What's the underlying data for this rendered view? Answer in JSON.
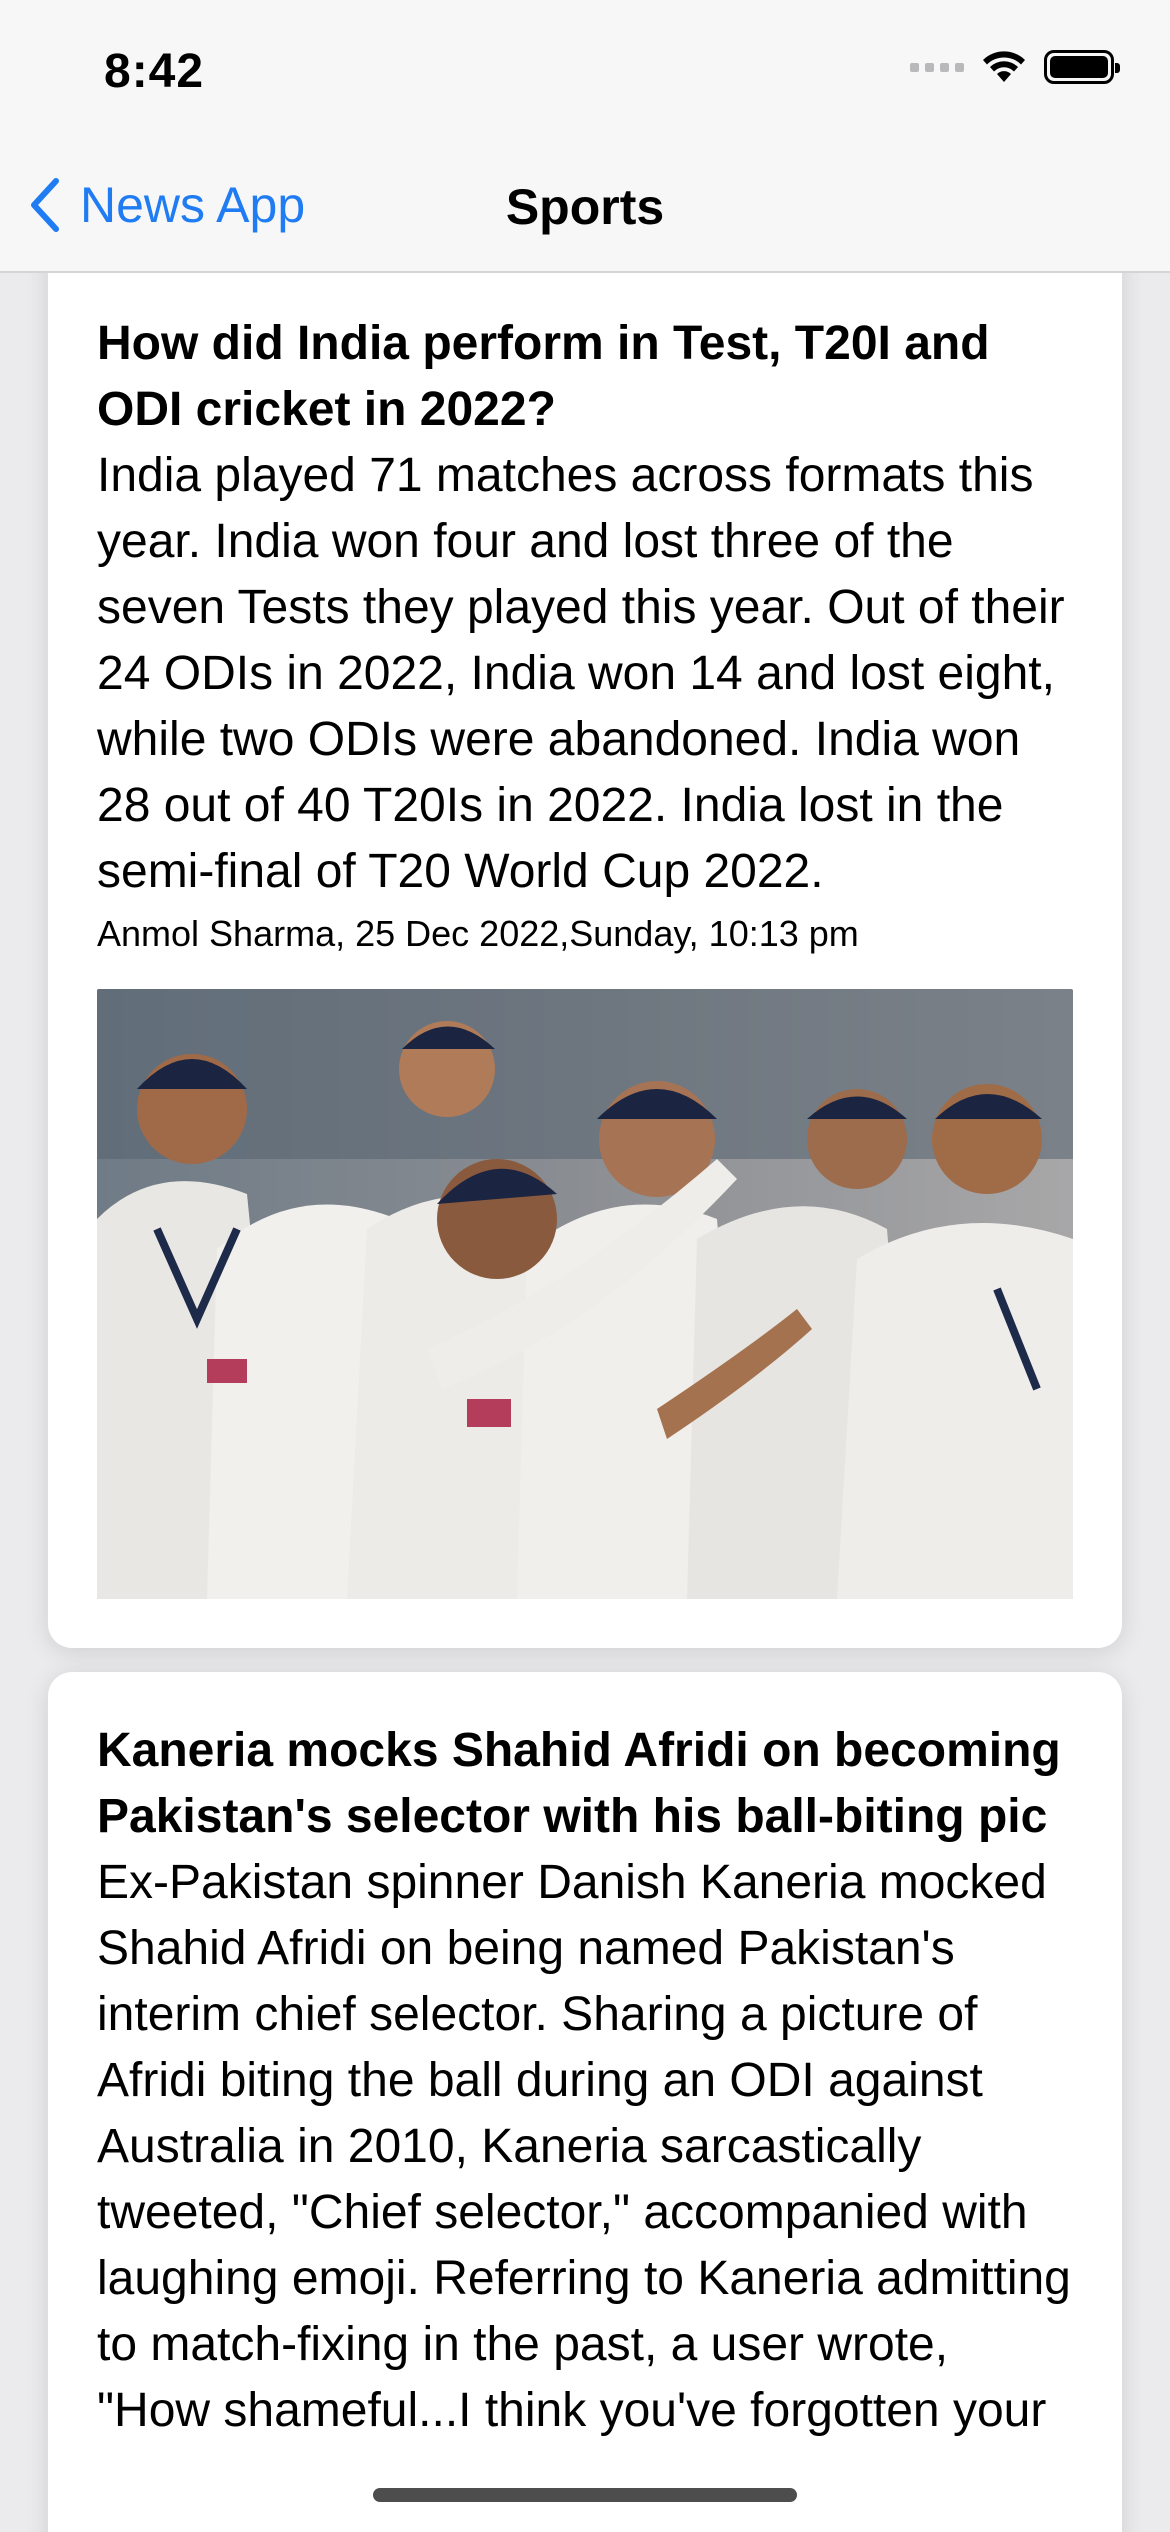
{
  "status_bar": {
    "time": "8:42",
    "signal_icon": "cellular-signal-icon",
    "wifi_icon": "wifi-icon",
    "battery_icon": "battery-full-icon"
  },
  "nav": {
    "back_label": "News App",
    "back_icon": "chevron-left-icon",
    "title": "Sports",
    "accent_color": "#1f7cf2"
  },
  "articles": [
    {
      "headline": "How did India perform in Test, T20I and ODI cricket in 2022?",
      "summary": "India played 71 matches across formats this year. India won four and lost three of the seven Tests they played this year. Out of their 24 ODIs in 2022, India won 14 and lost eight, while two ODIs were abandoned. India won 28 out of 40 T20Is in 2022. India lost in the semi-final of T20 World Cup 2022.",
      "meta": "Anmol Sharma, 25 Dec 2022,Sunday, 10:13 pm",
      "image": "cricket-team-celebration-photo"
    },
    {
      "headline": "Kaneria mocks Shahid Afridi on becoming Pakistan's selector with his ball-biting pic",
      "summary": "Ex-Pakistan spinner Danish Kaneria mocked Shahid Afridi on being named Pakistan's interim chief selector. Sharing a picture of Afridi biting the ball during an ODI against Australia in 2010, Kaneria sarcastically tweeted, \"Chief selector,\" accompanied with laughing emoji. Referring to Kaneria admitting to match-fixing in the past, a user wrote, \"How shameful...I think you've forgotten your"
    }
  ]
}
